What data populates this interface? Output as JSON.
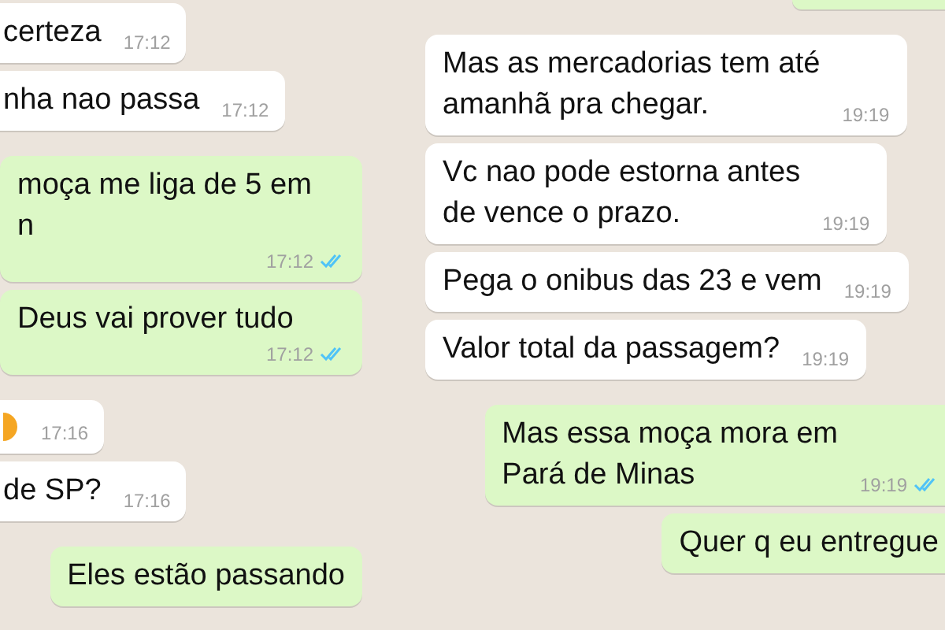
{
  "chats": [
    {
      "messages": [
        {
          "kind": "incoming",
          "text": "certeza",
          "time": "17:12"
        },
        {
          "kind": "incoming",
          "text": "nha nao passa",
          "time": "17:12"
        },
        {
          "kind": "outgoing",
          "text": "moça me liga de  5 em\nn",
          "time": "17:12",
          "read": true
        },
        {
          "kind": "outgoing",
          "text": "Deus vai prover tudo",
          "time": "17:12",
          "read": true
        },
        {
          "kind": "emoji",
          "time": "17:16"
        },
        {
          "kind": "incoming",
          "text": "de SP?",
          "time": "17:16"
        },
        {
          "kind": "outgoing",
          "text": "Eles estão passando"
        }
      ]
    },
    {
      "messages": [
        {
          "kind": "clipped"
        },
        {
          "kind": "incoming",
          "text": "Mas as mercadorias tem até\namanhã pra chegar.",
          "time": "19:19"
        },
        {
          "kind": "incoming",
          "text": "Vc nao pode estorna antes\nde vence  o prazo.",
          "time": "19:19"
        },
        {
          "kind": "incoming",
          "text": "Pega o onibus das 23 e vem",
          "time": "19:19"
        },
        {
          "kind": "incoming",
          "text": "Valor total da passagem?",
          "time": "19:19"
        },
        {
          "kind": "outgoing",
          "text": "Mas essa moça mora em\nPará de Minas",
          "time": "19:19",
          "read": true
        },
        {
          "kind": "outgoing",
          "text": "Quer q eu entregue"
        }
      ]
    }
  ]
}
